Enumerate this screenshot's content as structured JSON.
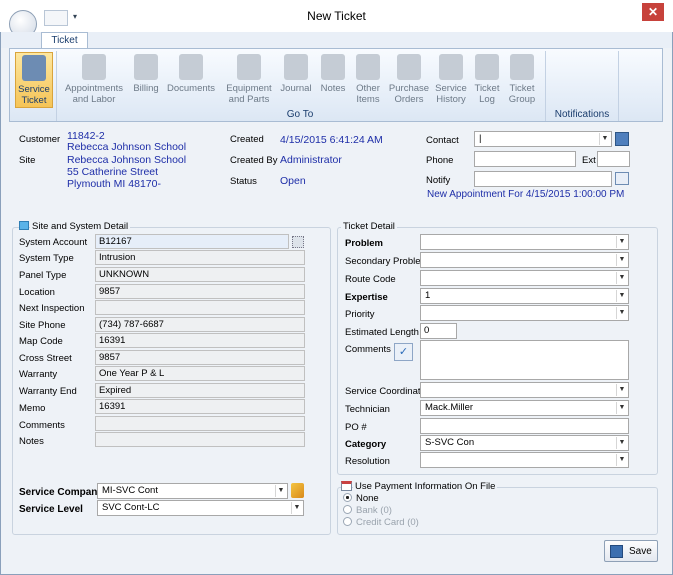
{
  "window": {
    "title": "New Ticket",
    "close": "✕"
  },
  "ribbon": {
    "tab": "Ticket",
    "buttons": [
      {
        "label1": "Service",
        "label2": "Ticket"
      },
      {
        "label1": "Appointments",
        "label2": "and Labor"
      },
      {
        "label1": "Billing",
        "label2": ""
      },
      {
        "label1": "Documents",
        "label2": ""
      },
      {
        "label1": "Equipment",
        "label2": "and Parts"
      },
      {
        "label1": "Journal",
        "label2": ""
      },
      {
        "label1": "Notes",
        "label2": ""
      },
      {
        "label1": "Other",
        "label2": "Items"
      },
      {
        "label1": "Purchase",
        "label2": "Orders"
      },
      {
        "label1": "Service",
        "label2": "History"
      },
      {
        "label1": "Ticket",
        "label2": "Log"
      },
      {
        "label1": "Ticket",
        "label2": "Group"
      }
    ],
    "goto_group": "Go To",
    "notifications_group": "Notifications"
  },
  "header": {
    "customer_label": "Customer",
    "customer_number": "11842-2",
    "customer_name": "Rebecca Johnson School",
    "site_label": "Site",
    "site_name": "Rebecca Johnson School",
    "site_address1": "55 Catherine Street",
    "site_address2": "Plymouth MI 48170-",
    "created_label": "Created",
    "created_value": "4/15/2015 6:41:24 AM",
    "created_by_label": "Created By",
    "created_by_value": "Administrator",
    "status_label": "Status",
    "status_value": "Open",
    "contact_label": "Contact",
    "contact_value": "|",
    "phone_label": "Phone",
    "ext_label": "Ext",
    "notify_label": "Notify",
    "appointment_link": "New Appointment For 4/15/2015 1:00:00 PM"
  },
  "site_detail": {
    "title": "Site and System Detail",
    "rows": [
      {
        "label": "System Account",
        "value": "B12167"
      },
      {
        "label": "System Type",
        "value": "Intrusion"
      },
      {
        "label": "Panel Type",
        "value": "UNKNOWN"
      },
      {
        "label": "Location",
        "value": "9857"
      },
      {
        "label": "Next Inspection",
        "value": ""
      },
      {
        "label": "Site Phone",
        "value": "(734) 787-6687"
      },
      {
        "label": "Map Code",
        "value": "16391"
      },
      {
        "label": "Cross Street",
        "value": "9857"
      },
      {
        "label": "Warranty",
        "value": "One Year P & L"
      },
      {
        "label": "Warranty End",
        "value": "Expired"
      },
      {
        "label": "Memo",
        "value": "16391"
      },
      {
        "label": "Comments",
        "value": ""
      },
      {
        "label": "Notes",
        "value": ""
      }
    ],
    "service_company_label": "Service Company",
    "service_company_value": "MI-SVC Cont",
    "service_level_label": "Service Level",
    "service_level_value": "SVC Cont-LC"
  },
  "ticket_detail": {
    "title": "Ticket Detail",
    "problem_label": "Problem",
    "secondary_problem_label": "Secondary Problem",
    "route_code_label": "Route Code",
    "expertise_label": "Expertise",
    "expertise_value": "1",
    "priority_label": "Priority",
    "estimated_length_label": "Estimated Length",
    "estimated_length_value": "0",
    "comments_label": "Comments",
    "service_coordinator_label": "Service Coordinator",
    "technician_label": "Technician",
    "technician_value": "Mack.Miller",
    "po_label": "PO #",
    "category_label": "Category",
    "category_value": "S-SVC Con",
    "resolution_label": "Resolution"
  },
  "payment": {
    "title": "Use Payment Information On File",
    "options": [
      "None",
      "Bank (0)",
      "Credit Card (0)"
    ],
    "selected": "None"
  },
  "save_label": "Save",
  "colors": {
    "link": "#1e2ea8",
    "ribbon_active": "#f5c457",
    "close": "#c7423b"
  }
}
